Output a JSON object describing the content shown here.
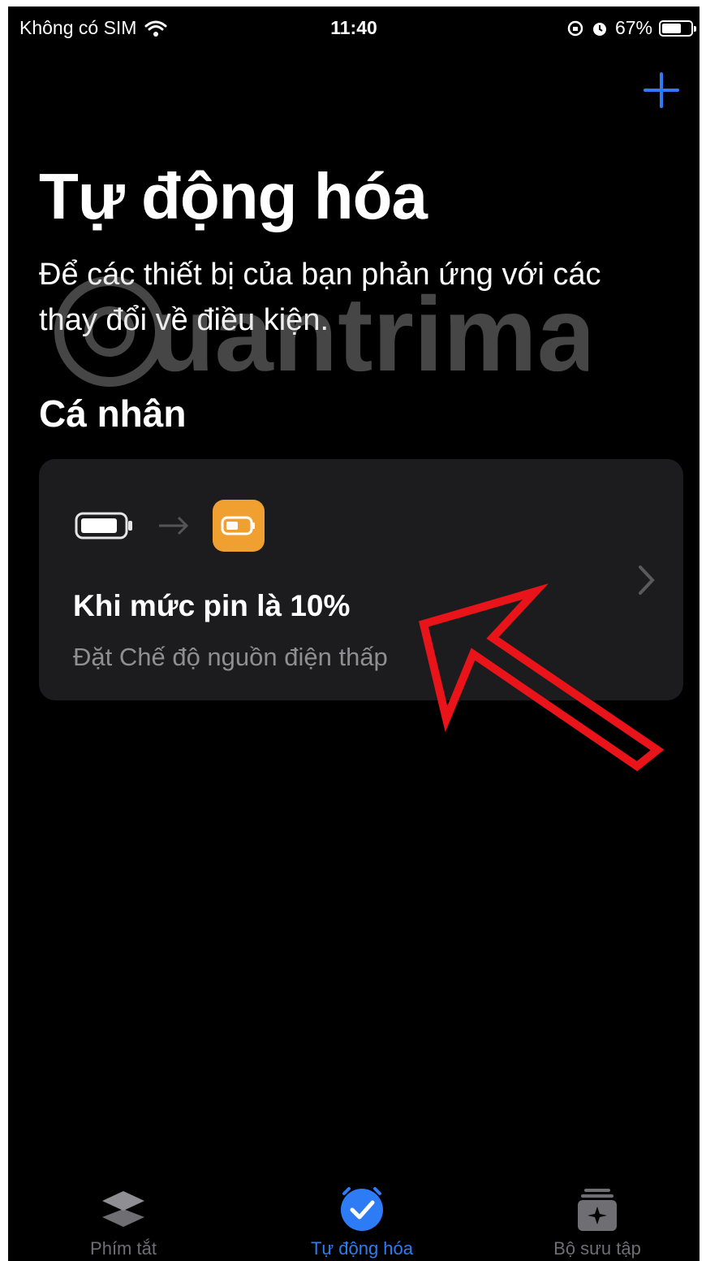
{
  "status_bar": {
    "carrier": "Không có SIM",
    "time": "11:40",
    "battery_percent": "67%",
    "battery_level": 0.67
  },
  "header": {
    "add_icon": "plus-icon",
    "title": "Tự động hóa",
    "subtitle": "Để các thiết bị của bạn phản ứng với các thay đổi về điều kiện."
  },
  "watermark": {
    "text": "uantrimang"
  },
  "section": {
    "title": "Cá nhân"
  },
  "automation_card": {
    "title": "Khi mức pin là 10%",
    "subtitle": "Đặt Chế độ nguồn điện thấp",
    "trigger_icon": "battery-icon",
    "action_icon": "low-power-mode-icon",
    "accent_color": "#f0a030"
  },
  "tab_bar": {
    "tabs": [
      {
        "label": "Phím tắt",
        "icon": "layers-icon",
        "active": false
      },
      {
        "label": "Tự động hóa",
        "icon": "clock-check-icon",
        "active": true
      },
      {
        "label": "Bộ sưu tập",
        "icon": "gallery-icon",
        "active": false
      }
    ],
    "active_color": "#2d7cf6"
  },
  "colors": {
    "background": "#000000",
    "card": "#1c1c1e",
    "accent_blue": "#2d7cf6",
    "annotation_red": "#e8141a"
  }
}
